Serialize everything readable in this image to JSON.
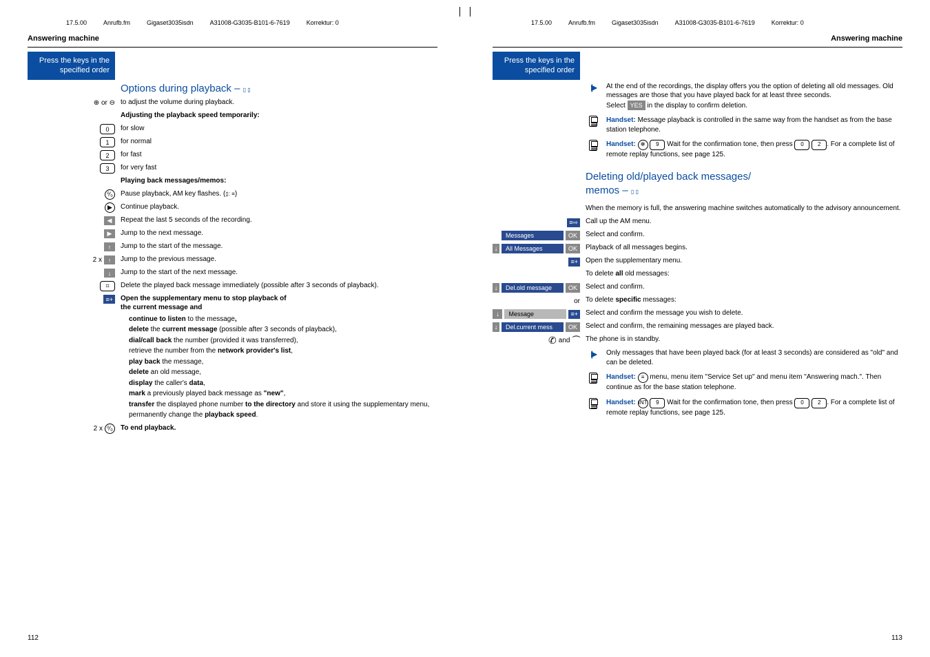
{
  "header": {
    "date": "17.5.00",
    "file": "Anrufb.fm",
    "product": "Gigaset3035isdn",
    "partno": "A31008-G3035-B101-6-7619",
    "korrektur": "Korrektur: 0"
  },
  "left": {
    "section_title": "Answering machine",
    "bluebox_l1": "Press the keys in the",
    "bluebox_l2": "specified order",
    "h2": "Options during playback – ",
    "rows": {
      "plusminus_prefix": "⊕ or ⊖",
      "plusminus": "to adjust the volume during playback.",
      "adjust_heading": "Adjusting the playback speed temporarily:",
      "k0": "0",
      "k0_txt": "for slow",
      "k1": "1",
      "k1_txt": "for normal",
      "k2": "2",
      "k2_txt": "for fast",
      "k3": "3",
      "k3_txt": "for very fast",
      "playing_heading": "Playing back messages/memos:",
      "pause_txt": "Pause playback, AM key flashes. (",
      "pause_suffix": ")",
      "cont_txt": "Continue playback.",
      "left5_txt": "Repeat the last 5 seconds of the recording.",
      "next_txt": "Jump to the next message.",
      "start_txt": "Jump to the start of the message.",
      "two_x": "2 x",
      "prev_txt": "Jump to the previous message.",
      "startnext_txt": "Jump to the start of the next message.",
      "del_txt": "Delete the played back message immediately (possible after 3 seconds of playback).",
      "supp_l1": "Open the supplementary menu to stop playback of",
      "supp_l2": "the current message and",
      "il_continue": "continue to listen to the message,",
      "il_delete1": "delete the current message (possible after 3 seconds of playback),",
      "il_dial": "dial/call back the number (provided it was transferred),",
      "il_retrieve": "retrieve the number from the network provider's list,",
      "il_playback": "play back the message,",
      "il_deleteold": "delete an old message,",
      "il_display": "display the caller's data,",
      "il_mark": "mark a previously played back message as \"new\",",
      "il_transfer": "transfer the displayed phone number to the directory and store it using the supplementary menu,",
      "il_perm": "permanently change the playback speed.",
      "end_prefix": "2 x",
      "end_txt": "To end playback."
    },
    "page_num": "112"
  },
  "right": {
    "section_title": "Answering machine",
    "bluebox_l1": "Press the keys in the",
    "bluebox_l2": "specified order",
    "note1": "At the end of the recordings, the display offers you the option of deleting all old messages. Old messages are those that you have played back for at least three seconds.",
    "note1b_pre": "Select ",
    "note1b_btn": "YES",
    "note1b_post": " in the display to confirm deletion.",
    "handset1_pre": "Handset:",
    "handset1_txt": " Message playback is controlled in the same way from the handset as from the base station telephone.",
    "handset2_pre": "Handset:",
    "handset2_wait": " ⊛ 9  Wait for the confirmation tone, then press  0  2 . For a complete list of remote replay functions, see page 125.",
    "h2_l1": "Deleting old/played back messages/",
    "h2_l2": "memos – ",
    "mem_full": "When the memory is full, the answering machine switches automatically to the advisory announcement.",
    "callup": "Call up the AM menu.",
    "messages": "Messages",
    "ok": "OK",
    "sel_confirm": "Select and confirm.",
    "all_msgs": "All Messages",
    "playback_all": "Playback of all messages begins.",
    "open_supp": "Open the supplementary menu.",
    "todel_all": "To delete all old messages:",
    "del_old": "Del.old message",
    "or": "or",
    "todel_spec": "To delete specific messages:",
    "message_item": "Message",
    "sel_wish": "Select and confirm the message you wish to delete.",
    "del_cur": "Del.current mess",
    "sel_remain": "Select and confirm, the remaining messages are played back.",
    "and": "and",
    "standby": "The phone is in standby.",
    "note2": "Only messages that have been played back (for at least 3 seconds) are considered as \"old\" and can be deleted.",
    "handset3_pre": "Handset:",
    "handset3_txt": " ≡ menu, menu item \"Service Set up\" and menu item \"Answering mach.\". Then continue as for the base station telephone.",
    "handset4_pre": "Handset:",
    "handset4_txt": " INT  9  Wait for the confirmation tone, then press  0  2 . For a complete list of remote replay functions, see page 125.",
    "page_num": "113"
  }
}
